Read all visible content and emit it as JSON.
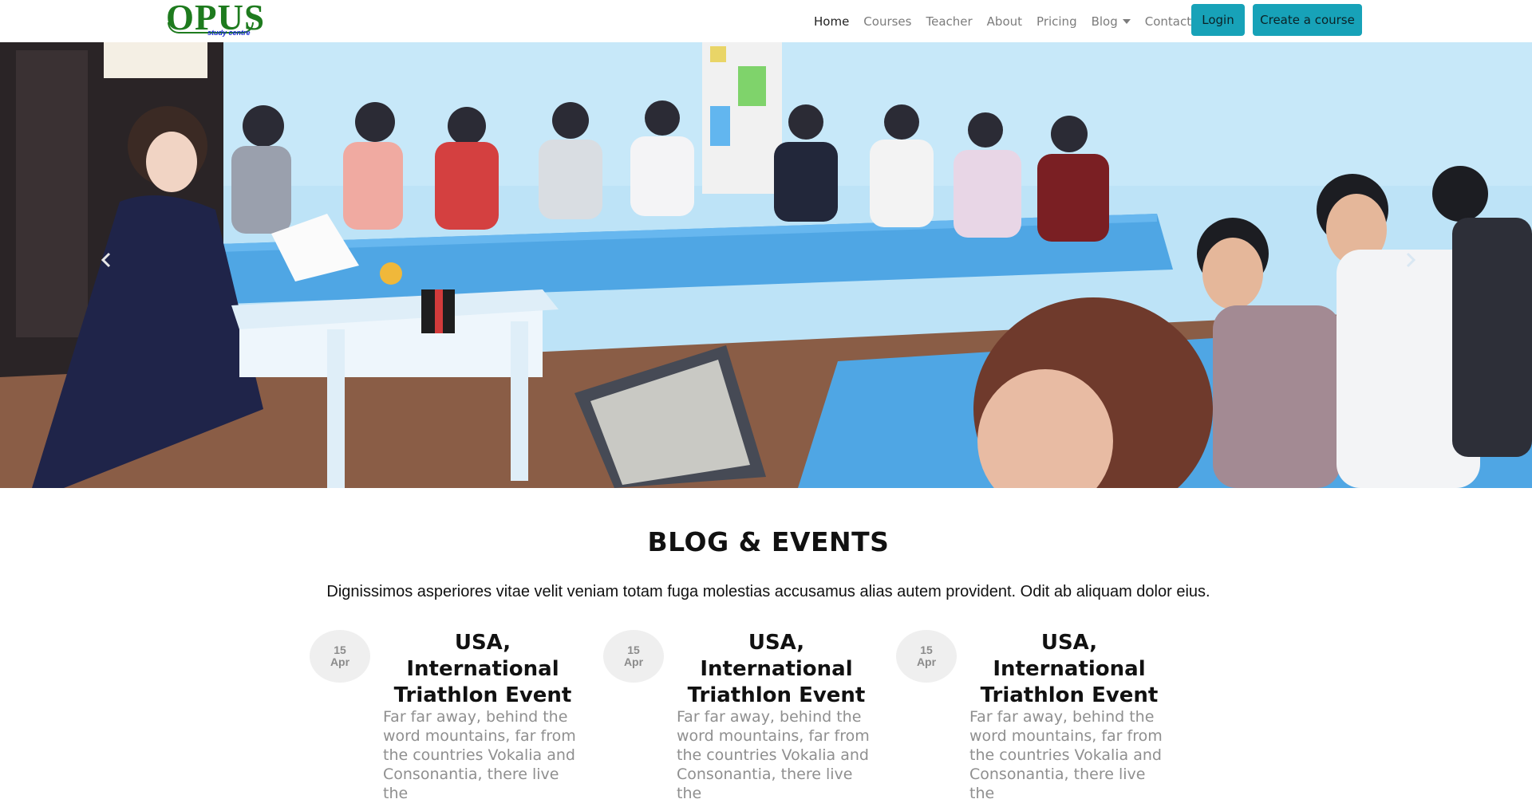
{
  "brand": {
    "logo_text": "OPUS",
    "logo_subtext": "study centre"
  },
  "nav": {
    "items": [
      {
        "label": "Home"
      },
      {
        "label": "Courses"
      },
      {
        "label": "Teacher"
      },
      {
        "label": "About"
      },
      {
        "label": "Pricing"
      },
      {
        "label": "Blog"
      },
      {
        "label": "Contacts"
      }
    ],
    "login_label": "Login",
    "create_label": "Create a course"
  },
  "hero": {
    "prev_icon": "chevron-left-icon",
    "next_icon": "chevron-right-icon"
  },
  "blog": {
    "title": "BLOG & EVENTS",
    "description": "Dignissimos asperiores vitae velit veniam totam fuga molestias accusamus alias autem provident. Odit ab aliquam dolor eius.",
    "cards": [
      {
        "day": "15",
        "month": "Apr",
        "title": "USA, International Triathlon Event",
        "text": "Far far away, behind the word mountains, far from the countries Vokalia and Consonantia, there live the"
      },
      {
        "day": "15",
        "month": "Apr",
        "title": "USA, International Triathlon Event",
        "text": "Far far away, behind the word mountains, far from the countries Vokalia and Consonantia, there live the"
      },
      {
        "day": "15",
        "month": "Apr",
        "title": "USA, International Triathlon Event",
        "text": "Far far away, behind the word mountains, far from the countries Vokalia and Consonantia, there live the"
      }
    ]
  },
  "colors": {
    "accent": "#17a2b8",
    "logo_green": "#1e7b1e",
    "logo_blue": "#1d2fd0"
  }
}
